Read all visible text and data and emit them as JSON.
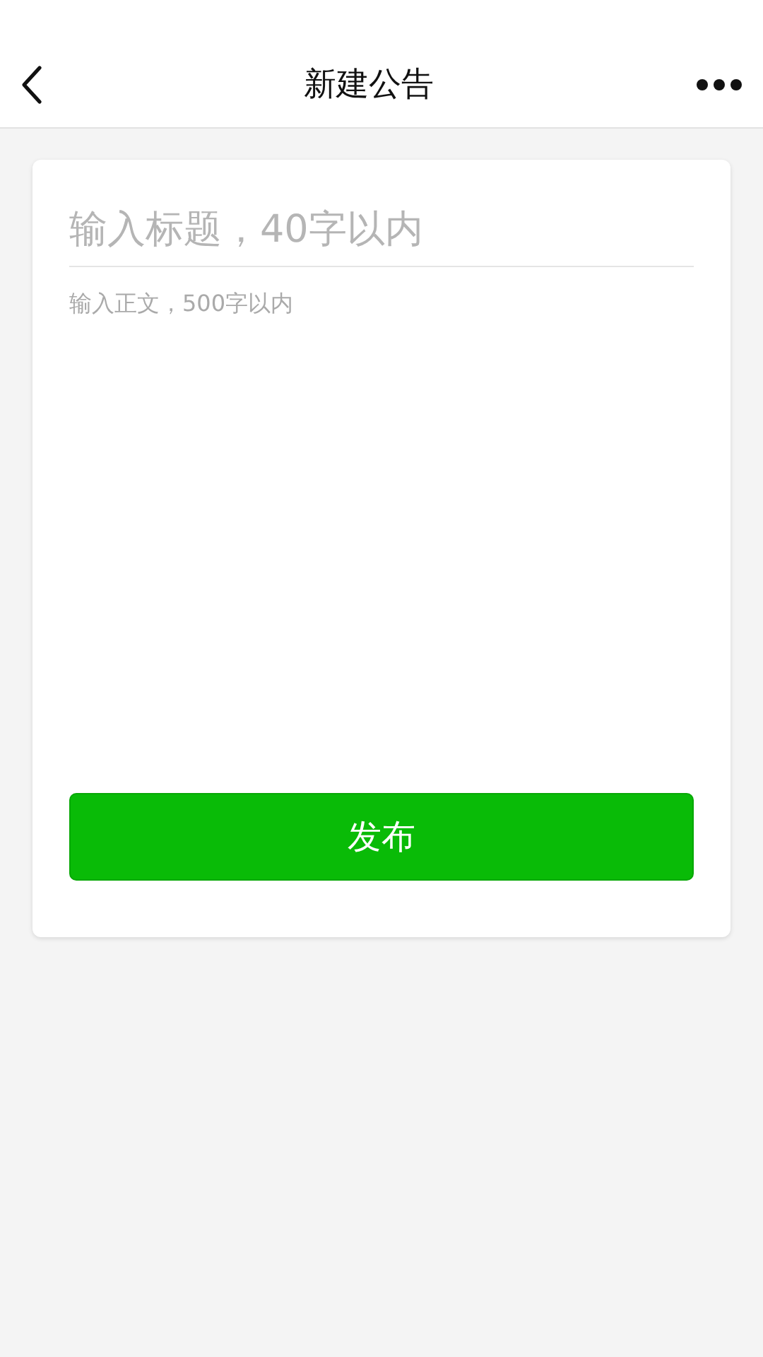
{
  "nav_bar": {
    "title": "新建公告"
  },
  "form": {
    "title_field": {
      "placeholder": "输入标题，40字以内"
    },
    "body_field": {
      "placeholder": "输入正文，500字以内"
    },
    "submit_button": {
      "label": "发布"
    }
  }
}
